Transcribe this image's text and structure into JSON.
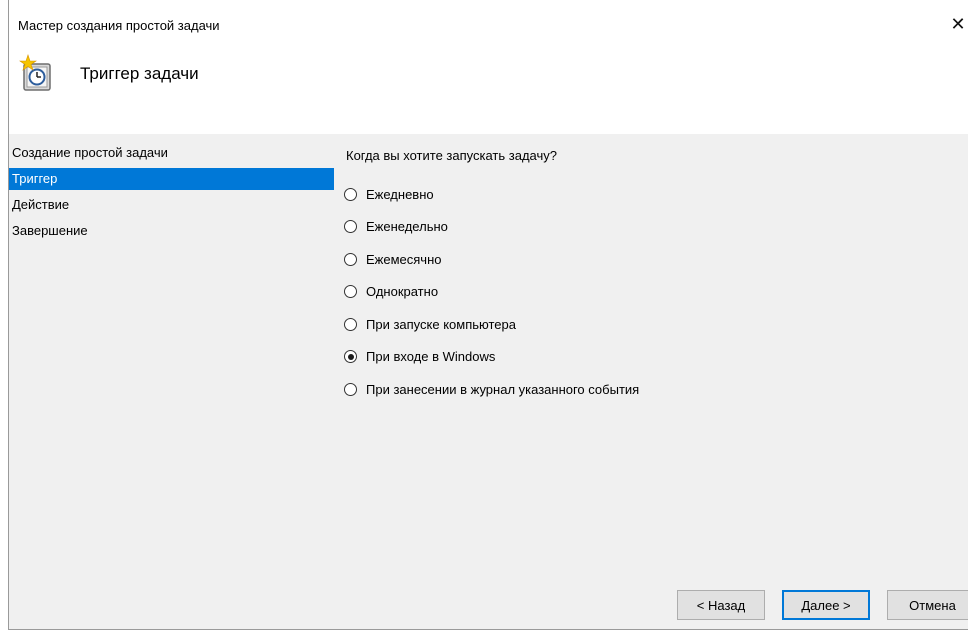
{
  "window": {
    "title": "Мастер создания простой задачи",
    "close_glyph": "✕"
  },
  "header": {
    "title": "Триггер задачи",
    "icon": "clock-star-icon"
  },
  "sidebar": {
    "items": [
      {
        "label": "Создание простой задачи"
      },
      {
        "label": "Триггер"
      },
      {
        "label": "Действие"
      },
      {
        "label": "Завершение"
      }
    ],
    "active_index": 1
  },
  "main": {
    "question": "Когда вы хотите запускать задачу?",
    "options": [
      {
        "label": "Ежедневно",
        "checked": false
      },
      {
        "label": "Еженедельно",
        "checked": false
      },
      {
        "label": "Ежемесячно",
        "checked": false
      },
      {
        "label": "Однократно",
        "checked": false
      },
      {
        "label": "При запуске компьютера",
        "checked": false
      },
      {
        "label": "При входе в Windows",
        "checked": true
      },
      {
        "label": "При занесении в журнал указанного события",
        "checked": false
      }
    ]
  },
  "footer": {
    "back_label": "< Назад",
    "next_label": "Далее >",
    "cancel_label": "Отмена"
  },
  "colors": {
    "accent": "#0078d7",
    "panel_bg": "#f0f0f0",
    "button_bg": "#e1e1e1"
  }
}
